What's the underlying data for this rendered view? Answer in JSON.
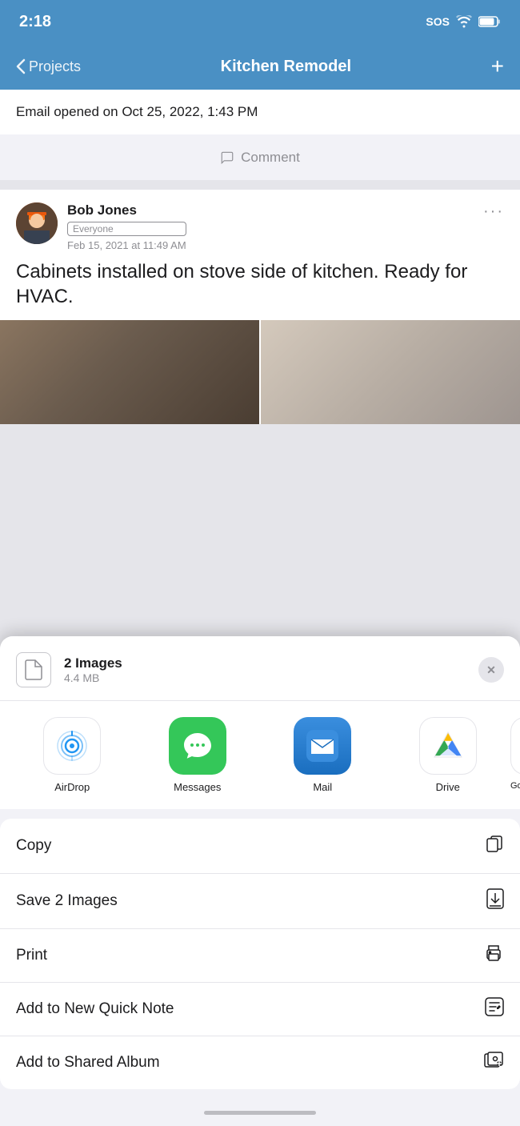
{
  "statusBar": {
    "time": "2:18",
    "sos": "SOS",
    "battery": "battery"
  },
  "navBar": {
    "back": "Projects",
    "title": "Kitchen Remodel",
    "add": "+"
  },
  "emailRow": {
    "text": "Email opened on Oct 25, 2022, 1:43 PM"
  },
  "commentRow": {
    "placeholder": "Comment"
  },
  "post": {
    "author": "Bob Jones",
    "audience": "Everyone",
    "date": "Feb 15, 2021 at 11:49 AM",
    "text": "Cabinets installed on stove side of kitchen. Ready for HVAC.",
    "more": "···"
  },
  "shareSheet": {
    "title": "2 Images",
    "subtitle": "4.4 MB",
    "closeButton": "✕",
    "apps": [
      {
        "name": "AirDrop",
        "id": "airdrop"
      },
      {
        "name": "Messages",
        "id": "messages"
      },
      {
        "name": "Mail",
        "id": "mail"
      },
      {
        "name": "Drive",
        "id": "drive"
      },
      {
        "name": "Goo…",
        "id": "google"
      }
    ],
    "actions": [
      {
        "label": "Copy",
        "icon": "copy"
      },
      {
        "label": "Save 2 Images",
        "icon": "save"
      },
      {
        "label": "Print",
        "icon": "print"
      },
      {
        "label": "Add to New Quick Note",
        "icon": "quicknote"
      },
      {
        "label": "Add to Shared Album",
        "icon": "sharedalbum"
      }
    ]
  }
}
